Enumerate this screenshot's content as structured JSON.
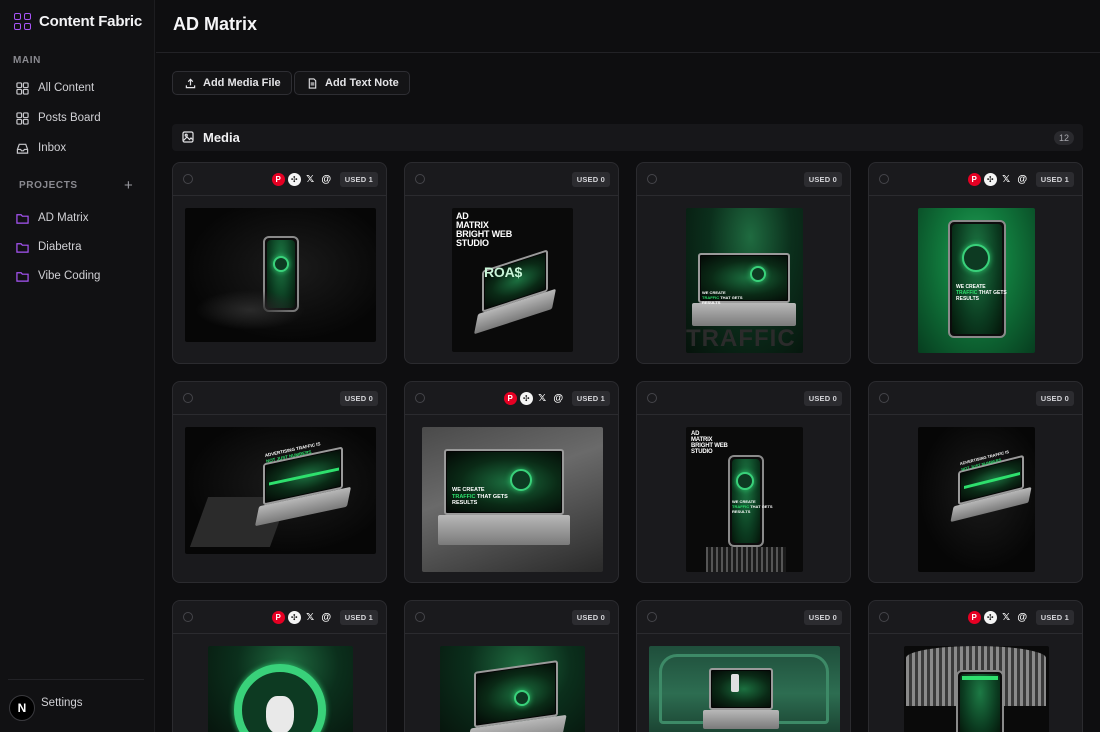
{
  "brand": {
    "name": "Content Fabric",
    "accent": "#a855f7"
  },
  "sidebar": {
    "main_label": "MAIN",
    "main_items": [
      {
        "label": "All Content",
        "icon": "grid-icon"
      },
      {
        "label": "Posts Board",
        "icon": "board-icon"
      },
      {
        "label": "Inbox",
        "icon": "inbox-icon"
      }
    ],
    "projects_label": "PROJECTS",
    "add_project": "+",
    "projects": [
      {
        "label": "AD Matrix",
        "icon": "folder-icon"
      },
      {
        "label": "Diabetra",
        "icon": "folder-icon"
      },
      {
        "label": "Vibe Coding",
        "icon": "folder-icon"
      }
    ],
    "settings_label": "Settings",
    "avatar_letter": "N"
  },
  "header": {
    "title": "AD Matrix"
  },
  "toolbar": {
    "add_media": "Add Media File",
    "add_note": "Add Text Note"
  },
  "media": {
    "title": "Media",
    "count": "12"
  },
  "cards": [
    {
      "used": "USED 1",
      "platforms": [
        "pinterest",
        "share",
        "x",
        "threads"
      ],
      "thumb": "phone-in-hand"
    },
    {
      "used": "USED 0",
      "platforms": [],
      "thumb": "roas-laptop",
      "text": {
        "headline1": "AD",
        "headline2": "MATRIX",
        "headline3": "BRIGHT WEB",
        "headline4": "STUDIO",
        "mark": "®",
        "roas": "ROA$"
      }
    },
    {
      "used": "USED 0",
      "platforms": [],
      "thumb": "traffic-laptop",
      "text": {
        "ghost": "TRAFFIC",
        "l1": "WE CREATE",
        "l2a": "TRAFFIC",
        "l2b": " THAT GETS",
        "l3": "RESULTS"
      }
    },
    {
      "used": "USED 1",
      "platforms": [
        "pinterest",
        "share",
        "x",
        "threads"
      ],
      "thumb": "green-phone",
      "text": {
        "l1": "WE CREATE",
        "l2a": "TRAFFIC",
        "l2b": " THAT GETS",
        "l3": "RESULTS"
      }
    },
    {
      "used": "USED 0",
      "platforms": [],
      "thumb": "laptop-table",
      "text": {
        "l1": "ADVERTISING TRAFFIC IS",
        "l2": "NOT JUST NUMBERS"
      }
    },
    {
      "used": "USED 1",
      "platforms": [
        "pinterest",
        "share",
        "x",
        "threads"
      ],
      "thumb": "laptop-grey",
      "text": {
        "l1": "WE CREATE",
        "l2a": "TRAFFIC",
        "l2b": " THAT GETS",
        "l3": "RESULTS"
      }
    },
    {
      "used": "USED 0",
      "platforms": [],
      "thumb": "phone-pedestal",
      "text": {
        "headline1": "AD",
        "headline2": "MATRIX",
        "headline3": "BRIGHT WEB",
        "headline4": "STUDIO",
        "l1": "WE CREATE",
        "l2a": "TRAFFIC",
        "l2b": " THAT GETS",
        "l3": "RESULTS"
      }
    },
    {
      "used": "USED 0",
      "platforms": [],
      "thumb": "laptop-dark",
      "text": {
        "l1": "ADVERTISING TRAFFIC IS",
        "l2": "NOT JUST NUMBERS"
      }
    },
    {
      "used": "USED 1",
      "platforms": [
        "pinterest",
        "share",
        "x",
        "threads"
      ],
      "thumb": "bunny-emblem"
    },
    {
      "used": "USED 0",
      "platforms": [],
      "thumb": "laptop-green-top"
    },
    {
      "used": "USED 0",
      "platforms": [],
      "thumb": "laptop-chair"
    },
    {
      "used": "USED 1",
      "platforms": [
        "pinterest",
        "share",
        "x",
        "threads"
      ],
      "thumb": "phone-studio"
    }
  ]
}
